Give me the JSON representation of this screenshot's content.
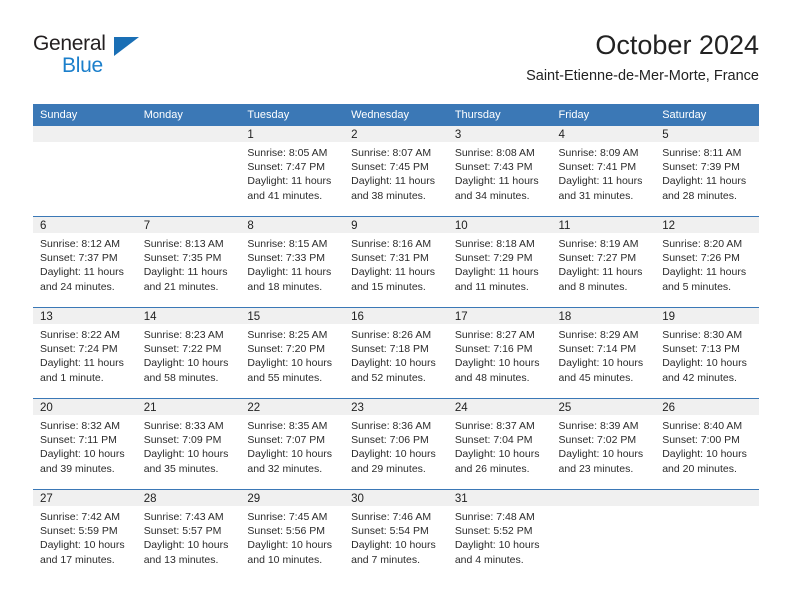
{
  "brand": {
    "name_top": "General",
    "name_bottom": "Blue",
    "triangle_color": "#1a6fb5",
    "blue_color": "#1b7fcb"
  },
  "header": {
    "month_title": "October 2024",
    "location": "Saint-Etienne-de-Mer-Morte, France"
  },
  "theme": {
    "header_bg": "#3b78b6",
    "daynum_bg": "#f0f0f0",
    "row_divider": "#3b78b6"
  },
  "calendar": {
    "weekday_headers": [
      "Sunday",
      "Monday",
      "Tuesday",
      "Wednesday",
      "Thursday",
      "Friday",
      "Saturday"
    ],
    "weeks": [
      [
        {
          "day": "",
          "empty": true
        },
        {
          "day": "",
          "empty": true
        },
        {
          "day": "1",
          "sunrise": "Sunrise: 8:05 AM",
          "sunset": "Sunset: 7:47 PM",
          "daylight1": "Daylight: 11 hours",
          "daylight2": "and 41 minutes."
        },
        {
          "day": "2",
          "sunrise": "Sunrise: 8:07 AM",
          "sunset": "Sunset: 7:45 PM",
          "daylight1": "Daylight: 11 hours",
          "daylight2": "and 38 minutes."
        },
        {
          "day": "3",
          "sunrise": "Sunrise: 8:08 AM",
          "sunset": "Sunset: 7:43 PM",
          "daylight1": "Daylight: 11 hours",
          "daylight2": "and 34 minutes."
        },
        {
          "day": "4",
          "sunrise": "Sunrise: 8:09 AM",
          "sunset": "Sunset: 7:41 PM",
          "daylight1": "Daylight: 11 hours",
          "daylight2": "and 31 minutes."
        },
        {
          "day": "5",
          "sunrise": "Sunrise: 8:11 AM",
          "sunset": "Sunset: 7:39 PM",
          "daylight1": "Daylight: 11 hours",
          "daylight2": "and 28 minutes."
        }
      ],
      [
        {
          "day": "6",
          "sunrise": "Sunrise: 8:12 AM",
          "sunset": "Sunset: 7:37 PM",
          "daylight1": "Daylight: 11 hours",
          "daylight2": "and 24 minutes."
        },
        {
          "day": "7",
          "sunrise": "Sunrise: 8:13 AM",
          "sunset": "Sunset: 7:35 PM",
          "daylight1": "Daylight: 11 hours",
          "daylight2": "and 21 minutes."
        },
        {
          "day": "8",
          "sunrise": "Sunrise: 8:15 AM",
          "sunset": "Sunset: 7:33 PM",
          "daylight1": "Daylight: 11 hours",
          "daylight2": "and 18 minutes."
        },
        {
          "day": "9",
          "sunrise": "Sunrise: 8:16 AM",
          "sunset": "Sunset: 7:31 PM",
          "daylight1": "Daylight: 11 hours",
          "daylight2": "and 15 minutes."
        },
        {
          "day": "10",
          "sunrise": "Sunrise: 8:18 AM",
          "sunset": "Sunset: 7:29 PM",
          "daylight1": "Daylight: 11 hours",
          "daylight2": "and 11 minutes."
        },
        {
          "day": "11",
          "sunrise": "Sunrise: 8:19 AM",
          "sunset": "Sunset: 7:27 PM",
          "daylight1": "Daylight: 11 hours",
          "daylight2": "and 8 minutes."
        },
        {
          "day": "12",
          "sunrise": "Sunrise: 8:20 AM",
          "sunset": "Sunset: 7:26 PM",
          "daylight1": "Daylight: 11 hours",
          "daylight2": "and 5 minutes."
        }
      ],
      [
        {
          "day": "13",
          "sunrise": "Sunrise: 8:22 AM",
          "sunset": "Sunset: 7:24 PM",
          "daylight1": "Daylight: 11 hours",
          "daylight2": "and 1 minute."
        },
        {
          "day": "14",
          "sunrise": "Sunrise: 8:23 AM",
          "sunset": "Sunset: 7:22 PM",
          "daylight1": "Daylight: 10 hours",
          "daylight2": "and 58 minutes."
        },
        {
          "day": "15",
          "sunrise": "Sunrise: 8:25 AM",
          "sunset": "Sunset: 7:20 PM",
          "daylight1": "Daylight: 10 hours",
          "daylight2": "and 55 minutes."
        },
        {
          "day": "16",
          "sunrise": "Sunrise: 8:26 AM",
          "sunset": "Sunset: 7:18 PM",
          "daylight1": "Daylight: 10 hours",
          "daylight2": "and 52 minutes."
        },
        {
          "day": "17",
          "sunrise": "Sunrise: 8:27 AM",
          "sunset": "Sunset: 7:16 PM",
          "daylight1": "Daylight: 10 hours",
          "daylight2": "and 48 minutes."
        },
        {
          "day": "18",
          "sunrise": "Sunrise: 8:29 AM",
          "sunset": "Sunset: 7:14 PM",
          "daylight1": "Daylight: 10 hours",
          "daylight2": "and 45 minutes."
        },
        {
          "day": "19",
          "sunrise": "Sunrise: 8:30 AM",
          "sunset": "Sunset: 7:13 PM",
          "daylight1": "Daylight: 10 hours",
          "daylight2": "and 42 minutes."
        }
      ],
      [
        {
          "day": "20",
          "sunrise": "Sunrise: 8:32 AM",
          "sunset": "Sunset: 7:11 PM",
          "daylight1": "Daylight: 10 hours",
          "daylight2": "and 39 minutes."
        },
        {
          "day": "21",
          "sunrise": "Sunrise: 8:33 AM",
          "sunset": "Sunset: 7:09 PM",
          "daylight1": "Daylight: 10 hours",
          "daylight2": "and 35 minutes."
        },
        {
          "day": "22",
          "sunrise": "Sunrise: 8:35 AM",
          "sunset": "Sunset: 7:07 PM",
          "daylight1": "Daylight: 10 hours",
          "daylight2": "and 32 minutes."
        },
        {
          "day": "23",
          "sunrise": "Sunrise: 8:36 AM",
          "sunset": "Sunset: 7:06 PM",
          "daylight1": "Daylight: 10 hours",
          "daylight2": "and 29 minutes."
        },
        {
          "day": "24",
          "sunrise": "Sunrise: 8:37 AM",
          "sunset": "Sunset: 7:04 PM",
          "daylight1": "Daylight: 10 hours",
          "daylight2": "and 26 minutes."
        },
        {
          "day": "25",
          "sunrise": "Sunrise: 8:39 AM",
          "sunset": "Sunset: 7:02 PM",
          "daylight1": "Daylight: 10 hours",
          "daylight2": "and 23 minutes."
        },
        {
          "day": "26",
          "sunrise": "Sunrise: 8:40 AM",
          "sunset": "Sunset: 7:00 PM",
          "daylight1": "Daylight: 10 hours",
          "daylight2": "and 20 minutes."
        }
      ],
      [
        {
          "day": "27",
          "sunrise": "Sunrise: 7:42 AM",
          "sunset": "Sunset: 5:59 PM",
          "daylight1": "Daylight: 10 hours",
          "daylight2": "and 17 minutes."
        },
        {
          "day": "28",
          "sunrise": "Sunrise: 7:43 AM",
          "sunset": "Sunset: 5:57 PM",
          "daylight1": "Daylight: 10 hours",
          "daylight2": "and 13 minutes."
        },
        {
          "day": "29",
          "sunrise": "Sunrise: 7:45 AM",
          "sunset": "Sunset: 5:56 PM",
          "daylight1": "Daylight: 10 hours",
          "daylight2": "and 10 minutes."
        },
        {
          "day": "30",
          "sunrise": "Sunrise: 7:46 AM",
          "sunset": "Sunset: 5:54 PM",
          "daylight1": "Daylight: 10 hours",
          "daylight2": "and 7 minutes."
        },
        {
          "day": "31",
          "sunrise": "Sunrise: 7:48 AM",
          "sunset": "Sunset: 5:52 PM",
          "daylight1": "Daylight: 10 hours",
          "daylight2": "and 4 minutes."
        },
        {
          "day": "",
          "empty": true
        },
        {
          "day": "",
          "empty": true
        }
      ]
    ]
  }
}
